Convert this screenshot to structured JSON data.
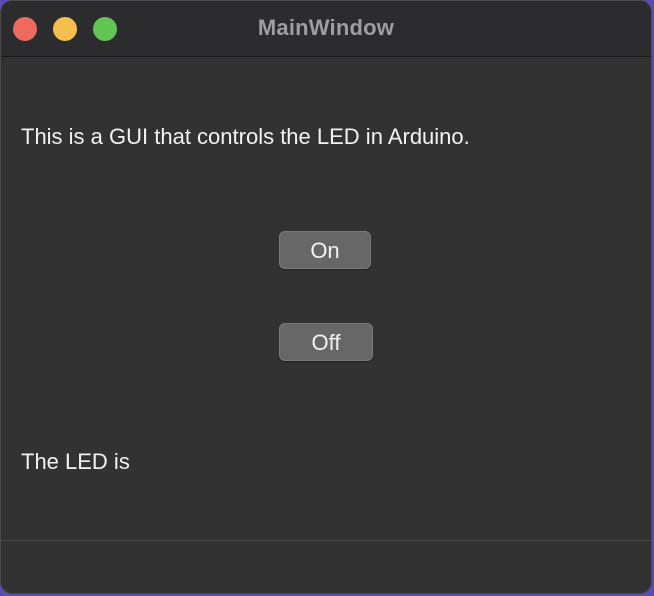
{
  "window": {
    "title": "MainWindow"
  },
  "main": {
    "description": "This is a GUI that controls the LED in Arduino.",
    "on_button_label": "On",
    "off_button_label": "Off",
    "status_label": "The LED is"
  },
  "colors": {
    "close": "#ed6a5e",
    "minimize": "#f5bf4f",
    "zoom": "#61c554",
    "background": "#323232",
    "button": "#676767"
  }
}
